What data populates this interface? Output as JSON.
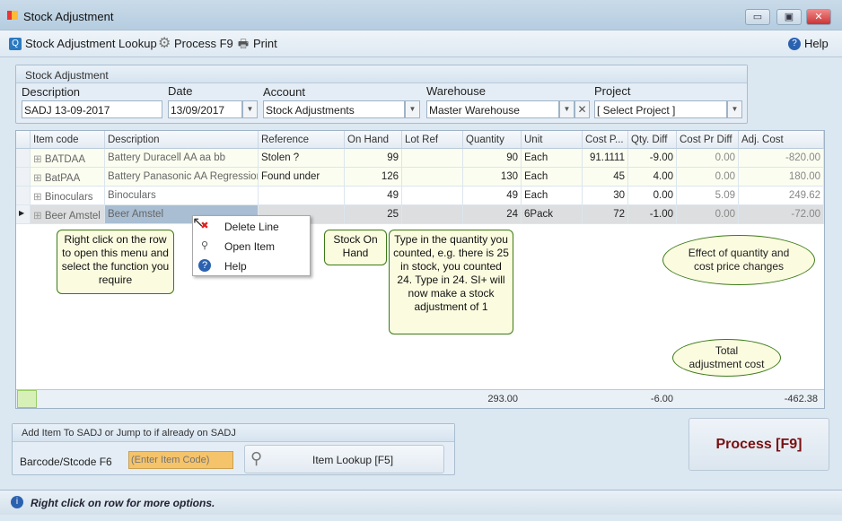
{
  "window": {
    "title": "Stock Adjustment",
    "minimize": "▭",
    "maximize": "▣",
    "close": "✕"
  },
  "toolbar": {
    "lookup": "Stock Adjustment Lookup",
    "process": "Process F9",
    "print": "Print",
    "help": "Help"
  },
  "header_group": {
    "title": "Stock Adjustment",
    "description_label": "Description",
    "description_value": "SADJ 13-09-2017",
    "date_label": "Date",
    "date_value": "13/09/2017",
    "account_label": "Account",
    "account_value": "Stock Adjustments",
    "warehouse_label": "Warehouse",
    "warehouse_value": "Master Warehouse",
    "project_label": "Project",
    "project_value": "[ Select Project ]"
  },
  "grid": {
    "columns": [
      "Item code",
      "Description",
      "Reference",
      "On Hand",
      "Lot Ref",
      "Quantity",
      "Unit",
      "Cost P...",
      "Qty. Diff",
      "Cost Pr Diff",
      "Adj. Cost"
    ],
    "rows": [
      [
        "BATDAA",
        "Battery Duracell AA aa bb",
        "Stolen ?",
        "99",
        "",
        "90",
        "Each",
        "91.1111",
        "-9.00",
        "0.00",
        "-820.00"
      ],
      [
        "BatPAA",
        "Battery Panasonic AA Regression)",
        "Found under",
        "126",
        "",
        "130",
        "Each",
        "45",
        "4.00",
        "0.00",
        "180.00"
      ],
      [
        "Binoculars",
        "Binoculars",
        "",
        "49",
        "",
        "49",
        "Each",
        "30",
        "0.00",
        "5.09",
        "249.62"
      ],
      [
        "Beer Amstel",
        "Beer Amstel",
        "",
        "25",
        "",
        "24",
        "6Pack",
        "72",
        "-1.00",
        "0.00",
        "-72.00"
      ]
    ],
    "selected_row": 3,
    "totals": {
      "quantity": "293.00",
      "qty_diff": "-6.00",
      "adj_cost": "-462.38"
    }
  },
  "context_menu": {
    "items": [
      "Delete Line",
      "Open Item",
      "Help"
    ]
  },
  "callouts": {
    "right_click": "Right click on the row to open this menu and select the function you require",
    "stock_on_hand": "Stock On Hand",
    "quantity": "Type in the quantity you counted, e.g. there is 25 in stock, you counted 24. Type in 24. SI+ will now make a stock adjustment of 1",
    "effect": "Effect of quantity and cost price changes",
    "total": "Total adjustment cost"
  },
  "add_item": {
    "title": "Add Item To SADJ or Jump to if already on SADJ",
    "barcode_label": "Barcode/Stcode F6",
    "barcode_placeholder": "(Enter Item Code)",
    "lookup_button": "Item Lookup [F5]"
  },
  "process_button": "Process [F9]",
  "status": {
    "text": "Right click on row for more options."
  },
  "colors": {
    "callout_border": "#3b7a17",
    "callout_fill": "#fbfbe0",
    "process_text": "#7a1010",
    "barcode_fill": "#f5c36a"
  }
}
